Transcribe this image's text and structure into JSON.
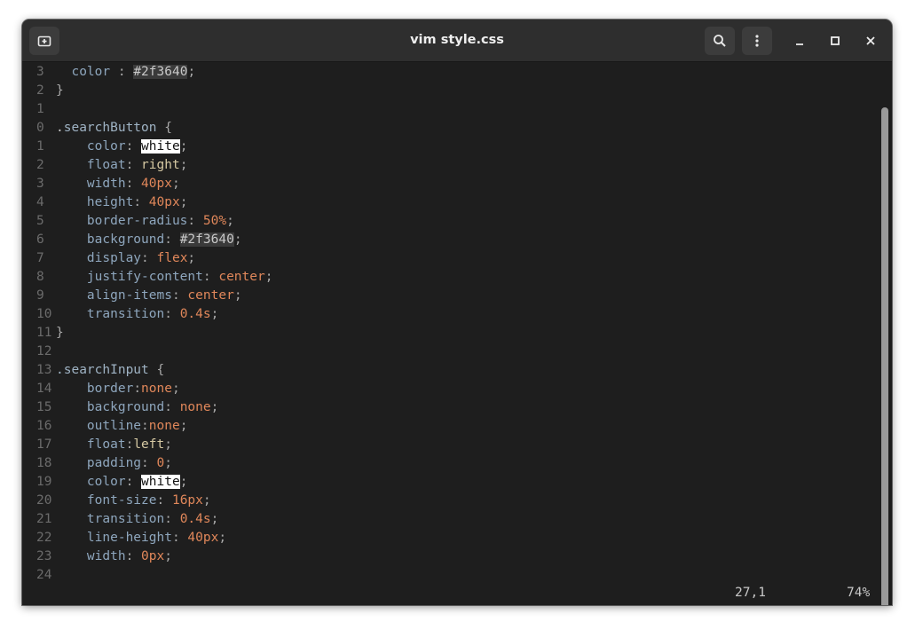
{
  "window": {
    "title": "vim style.css"
  },
  "editor": {
    "lines": [
      {
        "n": "3",
        "ind": "  ",
        "tokens": [
          [
            "prop",
            "color"
          ],
          [
            "punct",
            " : "
          ],
          [
            "hex",
            "#2f3640"
          ],
          [
            "punct",
            ";"
          ]
        ]
      },
      {
        "n": "2",
        "ind": "",
        "tokens": [
          [
            "punct",
            "}"
          ]
        ]
      },
      {
        "n": "1",
        "ind": "",
        "tokens": []
      },
      {
        "n": "0",
        "ind": "",
        "tokens": [
          [
            "cursor",
            "."
          ],
          [
            "sel",
            "searchButton"
          ],
          [
            "punct",
            " {"
          ]
        ]
      },
      {
        "n": "1",
        "ind": "    ",
        "tokens": [
          [
            "prop",
            "color"
          ],
          [
            "punct",
            ": "
          ],
          [
            "white",
            "white"
          ],
          [
            "punct",
            ";"
          ]
        ]
      },
      {
        "n": "2",
        "ind": "    ",
        "tokens": [
          [
            "prop",
            "float"
          ],
          [
            "punct",
            ": "
          ],
          [
            "ident",
            "right"
          ],
          [
            "punct",
            ";"
          ]
        ]
      },
      {
        "n": "3",
        "ind": "    ",
        "tokens": [
          [
            "prop",
            "width"
          ],
          [
            "punct",
            ": "
          ],
          [
            "num",
            "40px"
          ],
          [
            "punct",
            ";"
          ]
        ]
      },
      {
        "n": "4",
        "ind": "    ",
        "tokens": [
          [
            "prop",
            "height"
          ],
          [
            "punct",
            ": "
          ],
          [
            "num",
            "40px"
          ],
          [
            "punct",
            ";"
          ]
        ]
      },
      {
        "n": "5",
        "ind": "    ",
        "tokens": [
          [
            "prop",
            "border-radius"
          ],
          [
            "punct",
            ": "
          ],
          [
            "num",
            "50%"
          ],
          [
            "punct",
            ";"
          ]
        ]
      },
      {
        "n": "6",
        "ind": "    ",
        "tokens": [
          [
            "prop",
            "background"
          ],
          [
            "punct",
            ": "
          ],
          [
            "hex",
            "#2f3640"
          ],
          [
            "punct",
            ";"
          ]
        ]
      },
      {
        "n": "7",
        "ind": "    ",
        "tokens": [
          [
            "prop",
            "display"
          ],
          [
            "punct",
            ": "
          ],
          [
            "kw",
            "flex"
          ],
          [
            "punct",
            ";"
          ]
        ]
      },
      {
        "n": "8",
        "ind": "    ",
        "tokens": [
          [
            "prop",
            "justify-content"
          ],
          [
            "punct",
            ": "
          ],
          [
            "kw",
            "center"
          ],
          [
            "punct",
            ";"
          ]
        ]
      },
      {
        "n": "9",
        "ind": "    ",
        "tokens": [
          [
            "prop",
            "align-items"
          ],
          [
            "punct",
            ": "
          ],
          [
            "kw",
            "center"
          ],
          [
            "punct",
            ";"
          ]
        ]
      },
      {
        "n": "10",
        "ind": "    ",
        "tokens": [
          [
            "prop",
            "transition"
          ],
          [
            "punct",
            ": "
          ],
          [
            "num",
            "0.4s"
          ],
          [
            "punct",
            ";"
          ]
        ]
      },
      {
        "n": "11",
        "ind": "",
        "tokens": [
          [
            "punct",
            "}"
          ]
        ]
      },
      {
        "n": "12",
        "ind": "",
        "tokens": []
      },
      {
        "n": "13",
        "ind": "",
        "tokens": [
          [
            "sel",
            ".searchInput"
          ],
          [
            "punct",
            " {"
          ]
        ]
      },
      {
        "n": "14",
        "ind": "    ",
        "tokens": [
          [
            "prop",
            "border"
          ],
          [
            "punct",
            ":"
          ],
          [
            "kw",
            "none"
          ],
          [
            "punct",
            ";"
          ]
        ]
      },
      {
        "n": "15",
        "ind": "    ",
        "tokens": [
          [
            "prop",
            "background"
          ],
          [
            "punct",
            ": "
          ],
          [
            "kw",
            "none"
          ],
          [
            "punct",
            ";"
          ]
        ]
      },
      {
        "n": "16",
        "ind": "    ",
        "tokens": [
          [
            "prop",
            "outline"
          ],
          [
            "punct",
            ":"
          ],
          [
            "kw",
            "none"
          ],
          [
            "punct",
            ";"
          ]
        ]
      },
      {
        "n": "17",
        "ind": "    ",
        "tokens": [
          [
            "prop",
            "float"
          ],
          [
            "punct",
            ":"
          ],
          [
            "ident",
            "left"
          ],
          [
            "punct",
            ";"
          ]
        ]
      },
      {
        "n": "18",
        "ind": "    ",
        "tokens": [
          [
            "prop",
            "padding"
          ],
          [
            "punct",
            ": "
          ],
          [
            "num",
            "0"
          ],
          [
            "punct",
            ";"
          ]
        ]
      },
      {
        "n": "19",
        "ind": "    ",
        "tokens": [
          [
            "prop",
            "color"
          ],
          [
            "punct",
            ": "
          ],
          [
            "white",
            "white"
          ],
          [
            "punct",
            ";"
          ]
        ]
      },
      {
        "n": "20",
        "ind": "    ",
        "tokens": [
          [
            "prop",
            "font-size"
          ],
          [
            "punct",
            ": "
          ],
          [
            "num",
            "16px"
          ],
          [
            "punct",
            ";"
          ]
        ]
      },
      {
        "n": "21",
        "ind": "    ",
        "tokens": [
          [
            "prop",
            "transition"
          ],
          [
            "punct",
            ": "
          ],
          [
            "num",
            "0.4s"
          ],
          [
            "punct",
            ";"
          ]
        ]
      },
      {
        "n": "22",
        "ind": "    ",
        "tokens": [
          [
            "prop",
            "line-height"
          ],
          [
            "punct",
            ": "
          ],
          [
            "num",
            "40px"
          ],
          [
            "punct",
            ";"
          ]
        ]
      },
      {
        "n": "23",
        "ind": "    ",
        "tokens": [
          [
            "prop",
            "width"
          ],
          [
            "punct",
            ": "
          ],
          [
            "num",
            "0px"
          ],
          [
            "punct",
            ";"
          ]
        ]
      },
      {
        "n": "24",
        "ind": "",
        "tokens": []
      }
    ],
    "status": {
      "position": "27,1",
      "percent": "74%"
    }
  },
  "icons": {
    "new_tab": "new-tab-icon",
    "search": "search-icon",
    "menu": "kebab-menu-icon",
    "minimize": "minimize-icon",
    "maximize": "maximize-icon",
    "close": "close-icon"
  },
  "colors": {
    "background": "#1e1e1e",
    "titlebar": "#2e2e2e",
    "property": "#8ea6bd",
    "value_keyword": "#e0875a",
    "value_ident": "#d6c9a3",
    "selector": "#9fb3c4",
    "line_number": "#6b6b6b"
  }
}
